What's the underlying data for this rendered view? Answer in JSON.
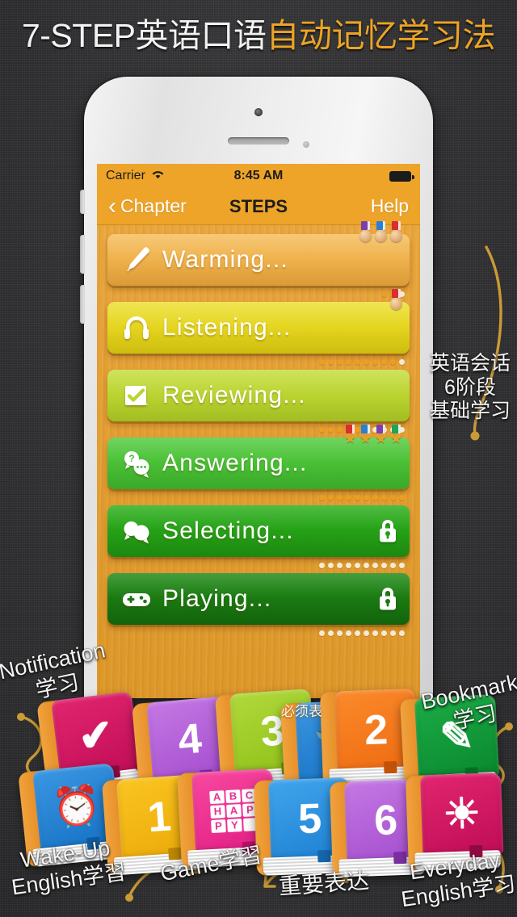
{
  "headline": {
    "white_part": "7-STEP英语口语",
    "orange_part": "自动记忆学习法",
    "orange_color": "#eda424",
    "white_color": "#f2f2f2"
  },
  "phone": {
    "status_bar": {
      "carrier": "Carrier",
      "wifi_icon": "wifi-icon",
      "time": "8:45 AM",
      "battery_icon": "battery-icon"
    },
    "nav_bar": {
      "back_chevron_icon": "chevron-left-icon",
      "back_label": "Chapter",
      "title": "STEPS",
      "help_label": "Help",
      "bar_color": "#eda428"
    },
    "steps": [
      {
        "label": "Warming...",
        "icon": "pencil-icon",
        "color": "#f0b24a",
        "locked": false,
        "medals": [
          {
            "ribbon_color": "#7a3fa8"
          },
          {
            "ribbon_color": "#2a7fd4"
          },
          {
            "ribbon_color": "#d6302f"
          }
        ],
        "medal_type": "bronze",
        "dots_total": 3,
        "dots_filled": 2
      },
      {
        "label": "Listening...",
        "icon": "headphones-icon",
        "color": "#e4d320",
        "locked": false,
        "medals": [
          {
            "ribbon_color": "#d6302f"
          }
        ],
        "medal_type": "bronze",
        "dots_total": 10,
        "dots_filled": 9
      },
      {
        "label": "Reviewing...",
        "icon": "checklist-icon",
        "color": "#b9d531",
        "locked": false,
        "medals": [],
        "medal_type": "bronze",
        "dots_total": 10,
        "dots_filled": 6
      },
      {
        "label": "Answering...",
        "icon": "speech-bubbles-question-icon",
        "color": "#47c135",
        "locked": false,
        "medals": [
          {
            "ribbon_color": "#d6302f"
          },
          {
            "ribbon_color": "#2a7fd4"
          },
          {
            "ribbon_color": "#7a3fa8"
          },
          {
            "ribbon_color": "#23a355"
          }
        ],
        "medal_type": "gold",
        "dots_total": 10,
        "dots_filled": 10
      },
      {
        "label": "Selecting...",
        "icon": "speech-bubbles-icon",
        "color": "#24a015",
        "locked": true,
        "lock_icon": "lock-icon",
        "medals": [],
        "medal_type": "bronze",
        "dots_total": 10,
        "dots_filled": 0
      },
      {
        "label": "Playing...",
        "icon": "gamepad-icon",
        "color": "#18780f",
        "locked": true,
        "lock_icon": "lock-icon",
        "medals": [],
        "medal_type": "bronze",
        "dots_total": 10,
        "dots_filled": 0
      }
    ]
  },
  "annotations": {
    "right_side": "英语会话\n6阶段\n基础学习",
    "right_side_lines": [
      "英语会话",
      "6阶段",
      "基础学习"
    ],
    "notification_lines": [
      "Notification",
      "学习"
    ],
    "bookmark_lines": [
      "Bookmark",
      "学习"
    ],
    "wakeup_lines": [
      "Wake-Up",
      "English学習"
    ],
    "game": "Game学習",
    "important": "重要表达",
    "everyday_lines": [
      "Everyday",
      "English学习"
    ],
    "bisu": "必须表"
  },
  "books": [
    {
      "name": "check-book",
      "glyph": "✔",
      "cover_color": "#d41a63",
      "row": 1
    },
    {
      "name": "four-book",
      "glyph": "4",
      "cover_color": "#b35fd8",
      "row": 1
    },
    {
      "name": "three-book",
      "glyph": "3",
      "cover_color": "#9ecb26",
      "row": 1
    },
    {
      "name": "wrench-book",
      "glyph": "🔧",
      "cover_color": "#1f7fd4",
      "row": 1
    },
    {
      "name": "two-book",
      "glyph": "2",
      "cover_color": "#f2741a",
      "row": 1
    },
    {
      "name": "marker-book",
      "glyph": "✎",
      "cover_color": "#12963a",
      "row": 1
    },
    {
      "name": "alarm-book",
      "glyph": "⏰",
      "cover_color": "#1f7fd4",
      "row": 2
    },
    {
      "name": "one-book",
      "glyph": "1",
      "cover_color": "#f0b81a",
      "row": 2
    },
    {
      "name": "abc-happy-book",
      "glyph": "ABCHAPPY",
      "cover_color": "#ee2d8c",
      "row": 2
    },
    {
      "name": "five-book",
      "glyph": "5",
      "cover_color": "#1f8fe0",
      "row": 2
    },
    {
      "name": "six-book",
      "glyph": "6",
      "cover_color": "#b35fd8",
      "row": 2
    },
    {
      "name": "sun-book",
      "glyph": "☀",
      "cover_color": "#d41a63",
      "row": 2
    }
  ],
  "abc_letters": [
    "A",
    "B",
    "C",
    "H",
    "A",
    "P",
    "P",
    "Y",
    ""
  ]
}
